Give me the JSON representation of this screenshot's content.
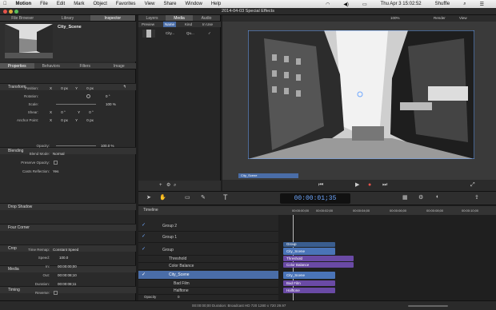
{
  "menubar": {
    "app": "Motion",
    "items": [
      "File",
      "Edit",
      "Mark",
      "Object",
      "Favorites",
      "View",
      "Share",
      "Window",
      "Help"
    ],
    "clock": "Thu Apr 3 15:02:52",
    "user": "Shuffle"
  },
  "window": {
    "title": "2014-04-03 Special Effects"
  },
  "left_tabs": [
    "File Browser",
    "Library",
    "Inspector"
  ],
  "preview": {
    "name": "City_Scene"
  },
  "inspector_tabs": [
    "Properties",
    "Behaviors",
    "Filters",
    "Image"
  ],
  "transform": {
    "title": "Transform",
    "position": {
      "label": "Position:",
      "x": "X",
      "xv": "0",
      "u": "px",
      "y": "Y",
      "yv": "0",
      "yu": "px"
    },
    "rotation": {
      "label": "Rotation:",
      "v": "0 °"
    },
    "scale": {
      "label": "Scale:",
      "v": "100 %"
    },
    "shear": {
      "label": "Shear:",
      "x": "X",
      "xv": "0 °",
      "y": "Y",
      "yv": "0 °"
    },
    "anchor": {
      "label": "Anchor Point:",
      "x": "X",
      "xv": "0",
      "u": "px",
      "y": "Y",
      "yv": "0",
      "yu": "px"
    }
  },
  "blending": {
    "title": "Blending",
    "opacity": {
      "label": "Opacity:",
      "v": "100.0 %"
    },
    "blend_mode": {
      "label": "Blend Mode:",
      "v": "Normal"
    },
    "preserve": {
      "label": "Preserve Opacity:"
    },
    "casts": {
      "label": "Casts Reflection:",
      "v": "Yes"
    }
  },
  "sections": {
    "drop_shadow": "Drop Shadow",
    "four_corner": "Four Corner",
    "crop": "Crop",
    "media": "Media",
    "timing": "Timing"
  },
  "timing": {
    "remap": {
      "label": "Time Remap:",
      "v": "Constant Speed"
    },
    "speed": {
      "label": "Speed:",
      "v": "100.0"
    },
    "in": {
      "label": "In:",
      "v": "00:00:00;00"
    },
    "out": {
      "label": "Out:",
      "v": "00:00:08;10"
    },
    "duration": {
      "label": "Duration:",
      "v": "00:00:08;11"
    },
    "reverse": {
      "label": "Reverse:"
    }
  },
  "layers_tabs": [
    "Layers",
    "Media",
    "Audio"
  ],
  "media_cols": [
    "Preview",
    "Name",
    "Kind",
    "In Use"
  ],
  "media_row": {
    "name": "City...",
    "kind": "Qu...",
    "inuse": "✓"
  },
  "canvas_bar": {
    "zoom": "100%",
    "render": "Render",
    "view": "View"
  },
  "canvas_track_label": "City_Scene",
  "timecode": "00:00:01;35",
  "timeline": {
    "title": "Timeline",
    "layers": [
      {
        "name": "Group 2"
      },
      {
        "name": "Group 1"
      },
      {
        "name": "Group"
      },
      {
        "name": "Threshold"
      },
      {
        "name": "Color Balance"
      },
      {
        "name": "City_Scene"
      },
      {
        "name": "Bad Film"
      },
      {
        "name": "Halftone"
      }
    ],
    "ruler": [
      "00:00:00;00",
      "00:00:02;00",
      "00:00:04;00",
      "00:00:06;00",
      "00:00:08;00",
      "00:00:10;00"
    ],
    "tracks": {
      "group": "Group",
      "city_scene": "City_Scene",
      "threshold": "Threshold",
      "color_balance": "Color Balance",
      "bad_film": "Bad Film",
      "halftone": "Halftone"
    }
  },
  "footer_left": {
    "opacity_label": "Opacity",
    "opacity_val": "0"
  },
  "status": "00:00:00;00 Duration: Broadcast HD 720 1280 x 720 29.97"
}
